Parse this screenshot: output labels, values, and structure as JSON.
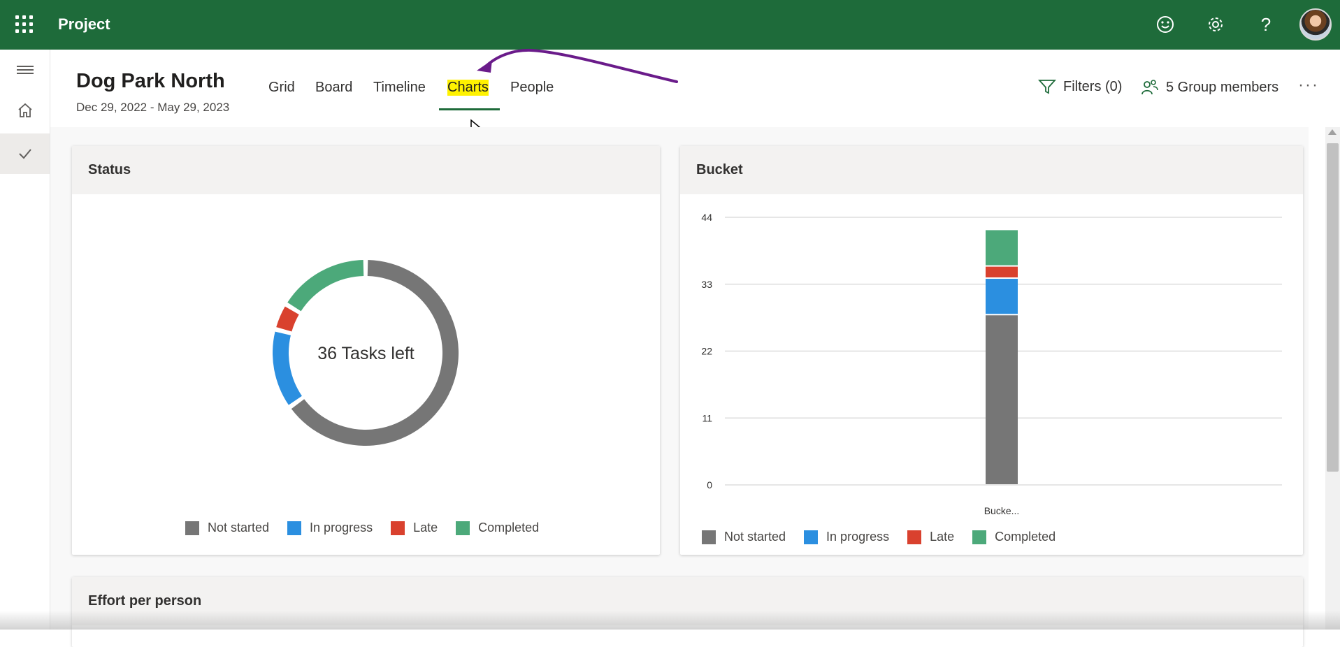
{
  "app": {
    "title": "Project"
  },
  "project": {
    "name": "Dog Park North",
    "dates": "Dec 29, 2022 - May 29, 2023"
  },
  "tabs": [
    {
      "label": "Grid"
    },
    {
      "label": "Board"
    },
    {
      "label": "Timeline"
    },
    {
      "label": "Charts",
      "selected": true
    },
    {
      "label": "People"
    }
  ],
  "toolbar": {
    "filters_label": "Filters (0)",
    "members_label": "5 Group members"
  },
  "icons": [
    "app-launcher-icon",
    "smiley-icon",
    "gear-icon",
    "help-icon",
    "hamburger-icon",
    "home-icon",
    "check-icon",
    "filter-icon",
    "people-icon",
    "more-icon",
    "pointer-cursor-icon",
    "annotation-arrow-icon"
  ],
  "colors": {
    "brand": "#1e6b3a",
    "not_started": "#767676",
    "in_progress": "#2b8fe0",
    "late": "#d9412e",
    "completed": "#4ca97a",
    "annotation": "#6a1b8a",
    "highlight": "#fff200"
  },
  "status_card": {
    "title": "Status",
    "center_label": "36 Tasks left",
    "legend": [
      "Not started",
      "In progress",
      "Late",
      "Completed"
    ]
  },
  "bucket_card": {
    "title": "Bucket",
    "legend": [
      "Not started",
      "In progress",
      "Late",
      "Completed"
    ]
  },
  "effort_card": {
    "title": "Effort per person"
  },
  "chart_data": [
    {
      "type": "pie",
      "title": "Status",
      "labels": [
        "Not started",
        "In progress",
        "Late",
        "Completed"
      ],
      "values": [
        28,
        6,
        2,
        7
      ],
      "center_text": "36 Tasks left"
    },
    {
      "type": "bar",
      "title": "Bucket",
      "categories": [
        "Bucke..."
      ],
      "stacked": true,
      "ylim": [
        0,
        44
      ],
      "yticks": [
        0,
        11,
        22,
        33,
        44
      ],
      "grid": true,
      "legend_position": "bottom",
      "series": [
        {
          "name": "Not started",
          "values": [
            28
          ]
        },
        {
          "name": "In progress",
          "values": [
            6
          ]
        },
        {
          "name": "Late",
          "values": [
            2
          ]
        },
        {
          "name": "Completed",
          "values": [
            6
          ]
        }
      ]
    }
  ]
}
